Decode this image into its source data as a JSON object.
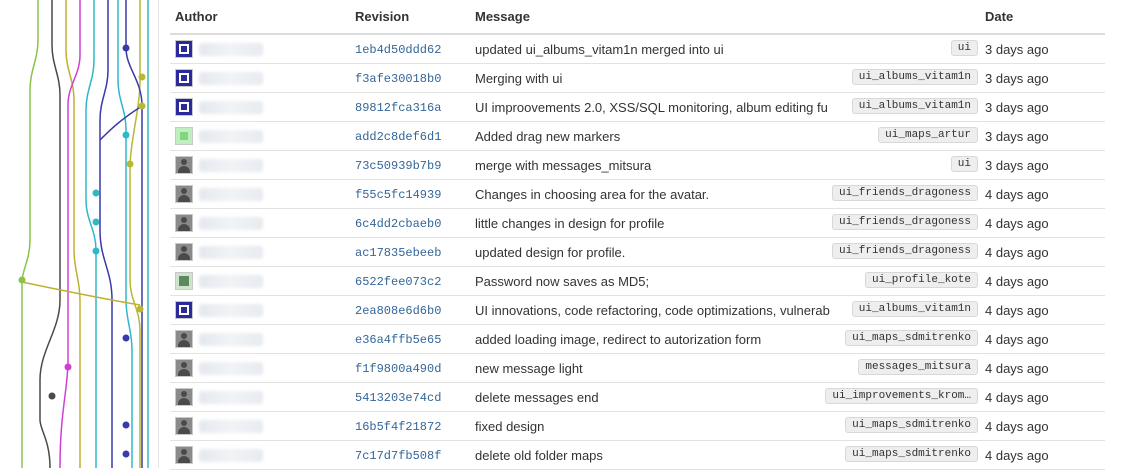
{
  "columns": {
    "author": "Author",
    "revision": "Revision",
    "message": "Message",
    "date": "Date"
  },
  "commits": [
    {
      "avatar": "blue-pattern",
      "revision": "1eb4d50ddd62",
      "message": "updated ui_albums_vitam1n merged into ui",
      "branch": "ui",
      "date": "3 days ago"
    },
    {
      "avatar": "blue-pattern",
      "revision": "f3afe30018b0",
      "message": "Merging with ui",
      "branch": "ui_albums_vitam1n",
      "date": "3 days ago"
    },
    {
      "avatar": "blue-pattern",
      "revision": "89812fca316a",
      "message": "UI improovements 2.0, XSS/SQL monitoring, album editing fu",
      "branch": "ui_albums_vitam1n",
      "date": "3 days ago"
    },
    {
      "avatar": "green-pattern",
      "revision": "add2c8def6d1",
      "message": "Added drag new markers",
      "branch": "ui_maps_artur",
      "date": "3 days ago"
    },
    {
      "avatar": "person",
      "revision": "73c50939b7b9",
      "message": "merge with messages_mitsura",
      "branch": "ui",
      "date": "3 days ago"
    },
    {
      "avatar": "person",
      "revision": "f55c5fc14939",
      "message": "Changes in choosing area for the avatar.",
      "branch": "ui_friends_dragoness",
      "date": "4 days ago"
    },
    {
      "avatar": "person",
      "revision": "6c4dd2cbaeb0",
      "message": "little changes in design for profile",
      "branch": "ui_friends_dragoness",
      "date": "4 days ago"
    },
    {
      "avatar": "person",
      "revision": "ac17835ebeeb",
      "message": "updated design for profile.",
      "branch": "ui_friends_dragoness",
      "date": "4 days ago"
    },
    {
      "avatar": "qr-pattern",
      "revision": "6522fee073c2",
      "message": "Password now saves as MD5;",
      "branch": "ui_profile_kote",
      "date": "4 days ago"
    },
    {
      "avatar": "blue-pattern",
      "revision": "2ea808e6d6b0",
      "message": "UI innovations, code refactoring, code optimizations, vulnerab",
      "branch": "ui_albums_vitam1n",
      "date": "4 days ago"
    },
    {
      "avatar": "person",
      "revision": "e36a4ffb5e65",
      "message": "added loading image, redirect to autorization form",
      "branch": "ui_maps_sdmitrenko",
      "date": "4 days ago"
    },
    {
      "avatar": "person",
      "revision": "f1f9800a490d",
      "message": "new message light",
      "branch": "messages_mitsura",
      "date": "4 days ago"
    },
    {
      "avatar": "person",
      "revision": "5413203e74cd",
      "message": "delete messages end",
      "branch": "ui_improvements_krom…",
      "date": "4 days ago"
    },
    {
      "avatar": "person",
      "revision": "16b5f4f21872",
      "message": "fixed design",
      "branch": "ui_maps_sdmitrenko",
      "date": "4 days ago"
    },
    {
      "avatar": "person",
      "revision": "7c17d7fb508f",
      "message": "delete old folder maps",
      "branch": "ui_maps_sdmitrenko",
      "date": "4 days ago"
    }
  ],
  "graph_colors": [
    "#8bc34a",
    "#4a4a4a",
    "#c0b030",
    "#d040d0",
    "#30b8c8",
    "#3a3aa8",
    "#b8b832"
  ]
}
